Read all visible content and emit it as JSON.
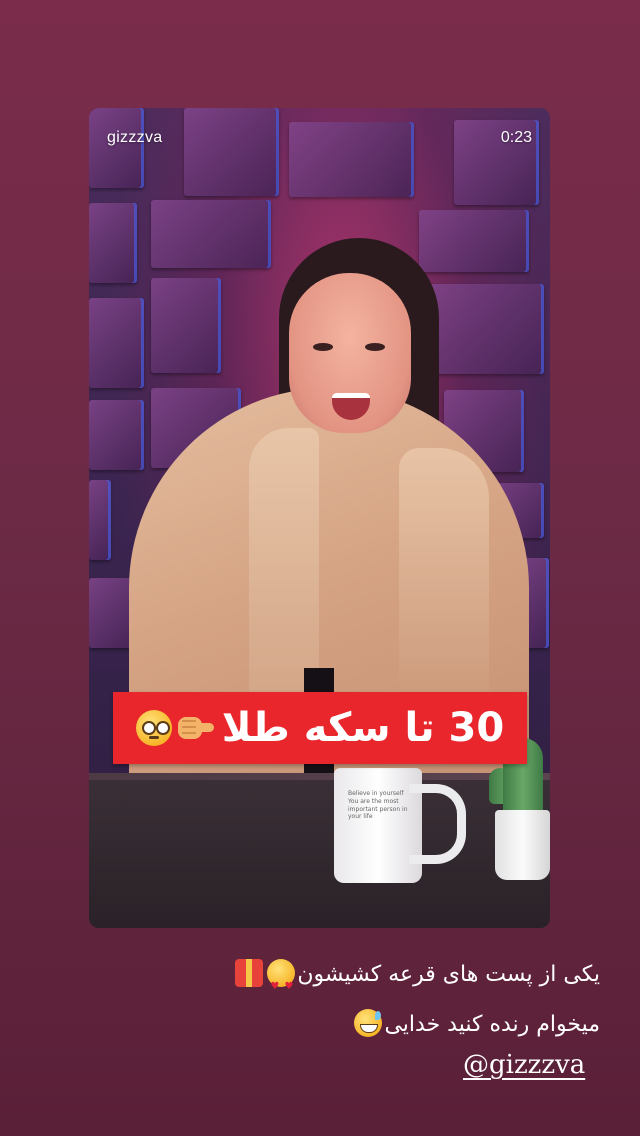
{
  "story": {
    "username": "gizzzva",
    "timer": "0:23",
    "banner_text": "30 تا سکه طلا",
    "banner_emojis": [
      "backhand-index-pointing-icon",
      "flushed-face-icon"
    ],
    "caption_line1": "یکی از پست های قرعه کشیشون",
    "caption_line1_emojis": [
      "heart-eyes-icon",
      "gift-icon"
    ],
    "caption_line2": "میخوام رنده کنید خدایی",
    "caption_line2_emojis": [
      "sweat-smile-icon"
    ],
    "mention": "@gizzzva"
  },
  "colors": {
    "background": "#6c2a45",
    "banner": "#e8262b",
    "text": "#ffffff"
  }
}
